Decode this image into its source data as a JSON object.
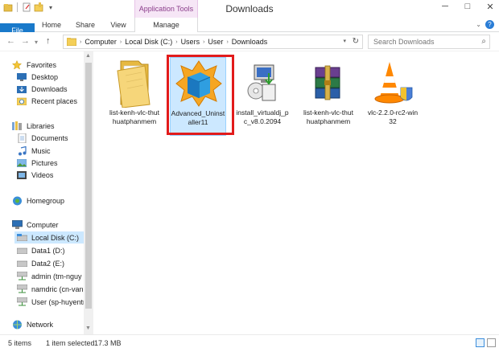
{
  "window": {
    "title": "Downloads",
    "context_tab_group": "Application Tools",
    "minimize_glyph": "─",
    "maximize_glyph": "□",
    "close_glyph": "✕"
  },
  "quick_access": {
    "icons": [
      "explorer-icon",
      "properties-icon",
      "new-folder-icon"
    ],
    "dropdown_glyph": "▾"
  },
  "ribbon": {
    "tabs": [
      "File",
      "Home",
      "Share",
      "View",
      "Manage"
    ],
    "expand_glyph": "⌄",
    "help_glyph": "?"
  },
  "navigation": {
    "back_glyph": "←",
    "forward_glyph": "→",
    "recent_glyph": "▾",
    "up_glyph": "↑"
  },
  "address": {
    "crumbs": [
      "Computer",
      "Local Disk (C:)",
      "Users",
      "User",
      "Downloads"
    ],
    "separator": "›",
    "dropdown_glyph": "▾",
    "refresh_glyph": "↻"
  },
  "search": {
    "placeholder": "Search Downloads",
    "icon_glyph": "⌕"
  },
  "nav_pane": {
    "favorites": {
      "label": "Favorites",
      "items": [
        "Desktop",
        "Downloads",
        "Recent places"
      ]
    },
    "libraries": {
      "label": "Libraries",
      "items": [
        "Documents",
        "Music",
        "Pictures",
        "Videos"
      ]
    },
    "homegroup": {
      "label": "Homegroup"
    },
    "computer": {
      "label": "Computer",
      "items": [
        "Local Disk (C:)",
        "Data1 (D:)",
        "Data2 (E:)",
        "admin (tm-nguy",
        "namdric (cn-van",
        "User (sp-huyentr"
      ]
    },
    "network": {
      "label": "Network"
    },
    "selected": "Local Disk (C:)",
    "scroll_up_glyph": "▲",
    "scroll_down_glyph": "▼"
  },
  "files": [
    {
      "name": "list-kenh-vlc-thuthuatphanmem",
      "line1": "list-kenh-vlc-thut",
      "line2": "huatphanmem",
      "icon": "folder-icon"
    },
    {
      "name": "Advanced_Uninstaller11",
      "line1": "Advanced_Uninst",
      "line2": "aller11",
      "icon": "advanced-uninstaller-icon",
      "selected": true
    },
    {
      "name": "install_virtualdj_pc_v8.0.2094",
      "line1": "install_virtualdj_p",
      "line2": "c_v8.0.2094",
      "icon": "installer-icon"
    },
    {
      "name": "list-kenh-vlc-thuthuatphanmem",
      "line1": "list-kenh-vlc-thut",
      "line2": "huatphanmem",
      "icon": "winrar-archive-icon"
    },
    {
      "name": "vlc-2.2.0-rc2-win32",
      "line1": "vlc-2.2.0-rc2-win",
      "line2": "32",
      "icon": "vlc-icon"
    }
  ],
  "status": {
    "count": "5 items",
    "selection": "1 item selected",
    "size": "17.3 MB"
  },
  "colors": {
    "file_tab": "#1979ca",
    "selection": "#cce8ff",
    "highlight_border": "#e21b1b",
    "context_tab": "#f6e6f6"
  }
}
